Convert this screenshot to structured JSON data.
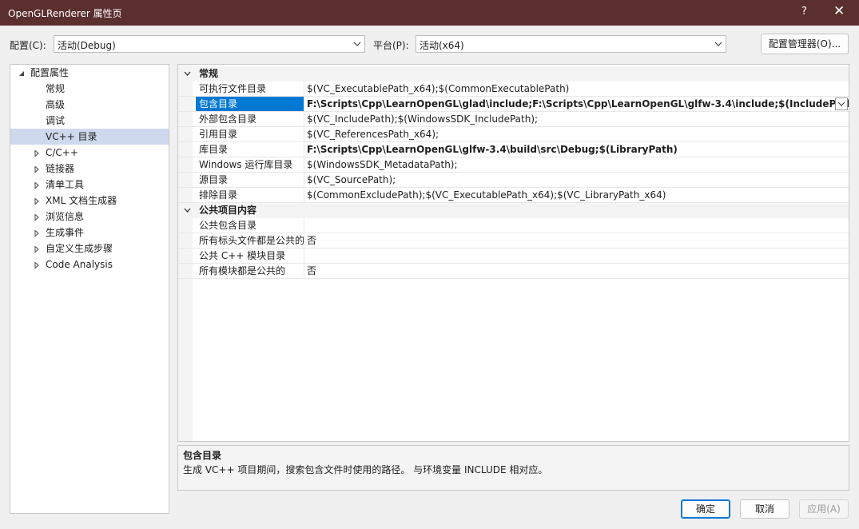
{
  "window": {
    "title": "OpenGLRenderer 属性页",
    "help": "?",
    "close": "✕"
  },
  "toolbar": {
    "config_label": "配置(C):",
    "config_value": "活动(Debug)",
    "platform_label": "平台(P):",
    "platform_value": "活动(x64)",
    "config_manager": "配置管理器(O)..."
  },
  "tree": {
    "root": "配置属性",
    "items": [
      {
        "label": "常规"
      },
      {
        "label": "高级"
      },
      {
        "label": "调试"
      },
      {
        "label": "VC++ 目录",
        "selected": true
      },
      {
        "label": "C/C++",
        "expandable": true
      },
      {
        "label": "链接器",
        "expandable": true
      },
      {
        "label": "清单工具",
        "expandable": true
      },
      {
        "label": "XML 文档生成器",
        "expandable": true
      },
      {
        "label": "浏览信息",
        "expandable": true
      },
      {
        "label": "生成事件",
        "expandable": true
      },
      {
        "label": "自定义生成步骤",
        "expandable": true
      },
      {
        "label": "Code Analysis",
        "expandable": true
      }
    ]
  },
  "grid": {
    "cat_general": "常规",
    "general": [
      {
        "name": "可执行文件目录",
        "value": "$(VC_ExecutablePath_x64);$(CommonExecutablePath)"
      },
      {
        "name": "包含目录",
        "value": "F:\\Scripts\\Cpp\\LearnOpenGL\\glad\\include;F:\\Scripts\\Cpp\\LearnOpenGL\\glfw-3.4\\include;$(IncludePath)",
        "bold": true,
        "selected": true
      },
      {
        "name": "外部包含目录",
        "value": "$(VC_IncludePath);$(WindowsSDK_IncludePath);"
      },
      {
        "name": "引用目录",
        "value": "$(VC_ReferencesPath_x64);"
      },
      {
        "name": "库目录",
        "value": "F:\\Scripts\\Cpp\\LearnOpenGL\\glfw-3.4\\build\\src\\Debug;$(LibraryPath)",
        "bold": true
      },
      {
        "name": "Windows 运行库目录",
        "value": "$(WindowsSDK_MetadataPath);"
      },
      {
        "name": "源目录",
        "value": "$(VC_SourcePath);"
      },
      {
        "name": "排除目录",
        "value": "$(CommonExcludePath);$(VC_ExecutablePath_x64);$(VC_LibraryPath_x64)"
      }
    ],
    "cat_public": "公共项目内容",
    "public": [
      {
        "name": "公共包含目录",
        "value": ""
      },
      {
        "name": "所有标头文件都是公共的",
        "value": "否"
      },
      {
        "name": "公共 C++ 模块目录",
        "value": ""
      },
      {
        "name": "所有模块都是公共的",
        "value": "否"
      }
    ]
  },
  "description": {
    "title": "包含目录",
    "text": "生成 VC++ 项目期间，搜索包含文件时使用的路径。 与环境变量 INCLUDE 相对应。"
  },
  "buttons": {
    "ok": "确定",
    "cancel": "取消",
    "apply": "应用(A)"
  },
  "colors": {
    "titlebar": "#5c2f2f",
    "selection": "#0078d4",
    "tree_selection": "#cfd9ee"
  }
}
